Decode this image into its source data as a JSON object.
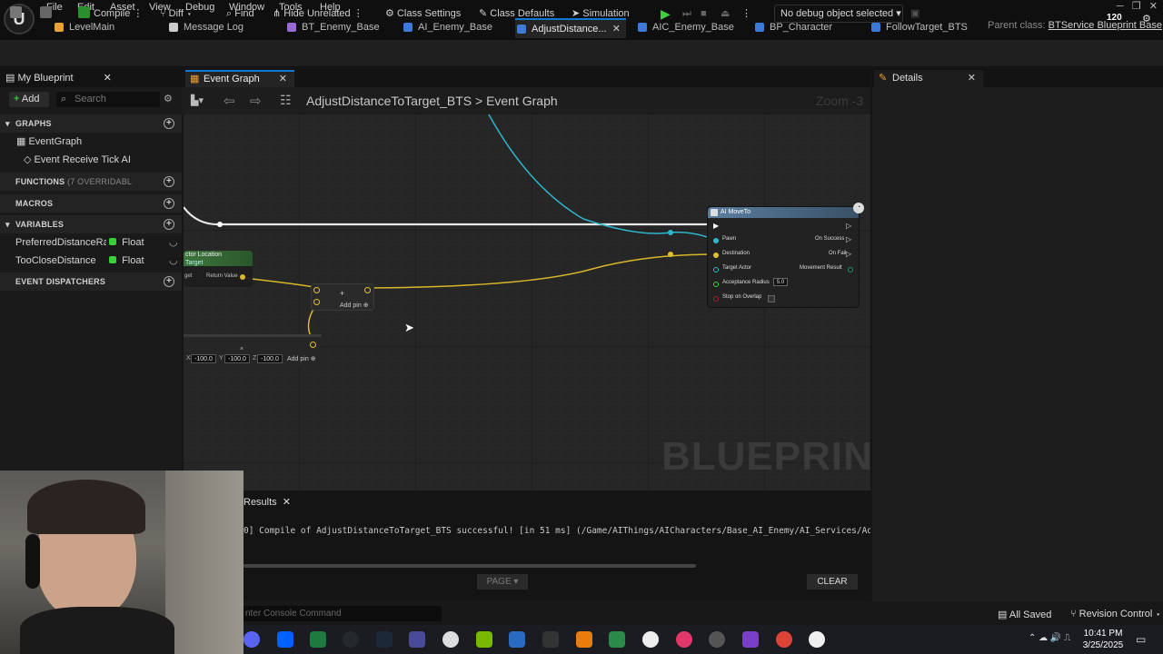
{
  "menu": [
    "File",
    "Edit",
    "Asset",
    "View",
    "Debug",
    "Window",
    "Tools",
    "Help"
  ],
  "fps": "120",
  "doc_tabs": [
    {
      "label": "LevelMain",
      "color": "#e8a03a"
    },
    {
      "label": "Message Log",
      "color": "#cccccc"
    },
    {
      "label": "BT_Enemy_Base",
      "color": "#9b6ad6"
    },
    {
      "label": "AI_Enemy_Base",
      "color": "#3d79d6"
    },
    {
      "label": "AdjustDistance...",
      "color": "#3d79d6"
    },
    {
      "label": "AIC_Enemy_Base",
      "color": "#3d79d6"
    },
    {
      "label": "BP_Character",
      "color": "#3d79d6"
    },
    {
      "label": "FollowTarget_BTS",
      "color": "#3d79d6"
    }
  ],
  "parent_class": {
    "label": "Parent class:",
    "value": "BTService Blueprint Base"
  },
  "toolbar": {
    "compile": "Compile",
    "diff": "Diff",
    "find": "Find",
    "hide_unrelated": "Hide Unrelated",
    "class_settings": "Class Settings",
    "class_defaults": "Class Defaults",
    "simulation": "Simulation",
    "debug_object": "No debug object selected"
  },
  "left_panel": {
    "tab": "My Blueprint",
    "add": "Add",
    "search_placeholder": "Search",
    "graphs_header": "GRAPHS",
    "event_graph": "EventGraph",
    "event_tick": "Event Receive Tick AI",
    "functions_header": "FUNCTIONS",
    "functions_sub": "(7 OVERRIDABL",
    "macros_header": "MACROS",
    "variables_header": "VARIABLES",
    "variables": [
      {
        "name": "PreferredDistanceRai",
        "type": "Float"
      },
      {
        "name": "TooCloseDistance",
        "type": "Float"
      }
    ],
    "dispatchers_header": "EVENT DISPATCHERS"
  },
  "graph": {
    "tab": "Event Graph",
    "breadcrumb_bp": "AdjustDistanceToTarget_BTS",
    "breadcrumb_sep": ">",
    "breadcrumb_graph": "Event Graph",
    "zoom": "Zoom -3",
    "watermark": "BLUEPRINT",
    "moveto": {
      "title": "AI MoveTo",
      "pins_in": [
        "Pawn",
        "Destination",
        "Target Actor",
        "Acceptance Radius",
        "Stop on Overlap"
      ],
      "pins_out": [
        "On Success",
        "On Fail",
        "Movement Result"
      ],
      "radius_value": "5.0"
    },
    "actor_location": {
      "title": "ctor Location",
      "sub": "Target",
      "return": "Return Value",
      "target_label": "get"
    },
    "add_pin": "Add pin",
    "vector_values": [
      "-100.0",
      "-100.0",
      "-100.0"
    ],
    "vector_axes": [
      "X",
      "Y",
      "Z"
    ]
  },
  "details": {
    "tab": "Details"
  },
  "results": {
    "tab": "Results",
    "line": "0] Compile of AdjustDistanceToTarget_BTS successful! [in 51 ms] (/Game/AIThings/AICharacters/Base_AI_Enemy/AI_Services/AdjustD",
    "page": "PAGE",
    "clear": "CLEAR"
  },
  "status": {
    "console_placeholder": "nter Console Command",
    "all_saved": "All Saved",
    "revision": "Revision Control"
  },
  "clock": {
    "time": "10:41 PM",
    "date": "3/25/2025"
  }
}
